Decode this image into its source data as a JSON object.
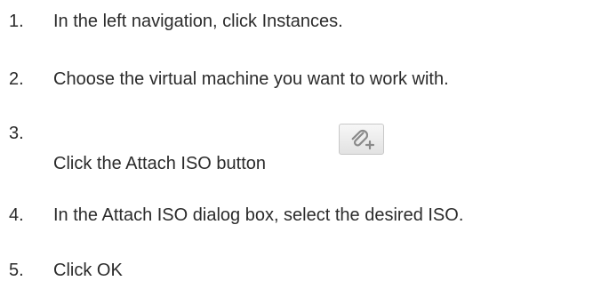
{
  "steps": [
    {
      "number": "1.",
      "text": "In the left navigation, click Instances."
    },
    {
      "number": "2.",
      "text": "Choose the virtual machine you want to work with."
    },
    {
      "number": "3.",
      "text": "Click the Attach ISO button",
      "button_icon": "attach-iso-icon"
    },
    {
      "number": "4.",
      "text": "In the Attach ISO dialog box, select the desired ISO."
    },
    {
      "number": "5.",
      "text": "Click OK"
    }
  ],
  "colors": {
    "text": "#2b2b2b",
    "button_background": "#ececec",
    "button_border": "#c8c8c8",
    "icon": "#8a8a8a"
  }
}
